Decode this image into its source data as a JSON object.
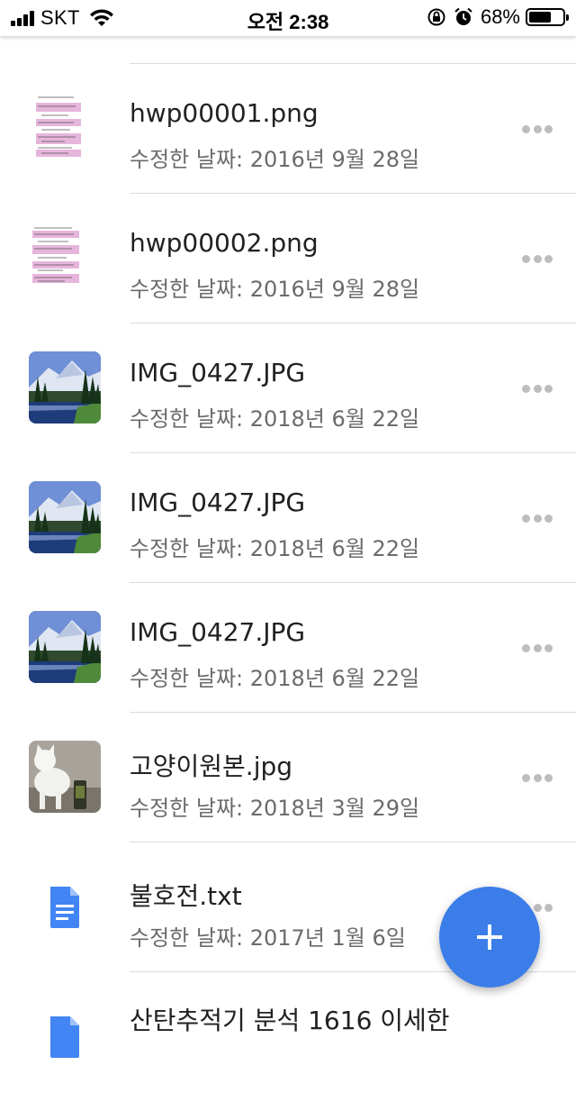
{
  "status_bar": {
    "carrier": "SKT",
    "time": "오전 2:38",
    "battery_percent": "68%",
    "battery_level": 0.68
  },
  "files": [
    {
      "name": "hwp00001.png",
      "date": "수정한 날짜: 2016년 9월 28일",
      "thumb": "document-thumbnail"
    },
    {
      "name": "hwp00002.png",
      "date": "수정한 날짜: 2016년 9월 28일",
      "thumb": "document-thumbnail"
    },
    {
      "name": "IMG_0427.JPG",
      "date": "수정한 날짜: 2018년 6월 22일",
      "thumb": "landscape-thumbnail"
    },
    {
      "name": "IMG_0427.JPG",
      "date": "수정한 날짜: 2018년 6월 22일",
      "thumb": "landscape-thumbnail"
    },
    {
      "name": "IMG_0427.JPG",
      "date": "수정한 날짜: 2018년 6월 22일",
      "thumb": "landscape-thumbnail"
    },
    {
      "name": "고양이원본.jpg",
      "date": "수정한 날짜: 2018년 3월 29일",
      "thumb": "cat-photo-thumbnail"
    },
    {
      "name": "불호전.txt",
      "date": "수정한 날짜: 2017년 1월 6일",
      "thumb": "text-file-icon"
    },
    {
      "name": "산탄추적기 분석 1616 이세한",
      "date": "",
      "thumb": "text-file-icon"
    }
  ],
  "colors": {
    "accent": "#3b7de9",
    "divider": "#dadce0",
    "secondary_text": "#6b6b6b"
  },
  "icons": {
    "more": "more-horiz-icon",
    "fab": "plus-icon"
  }
}
